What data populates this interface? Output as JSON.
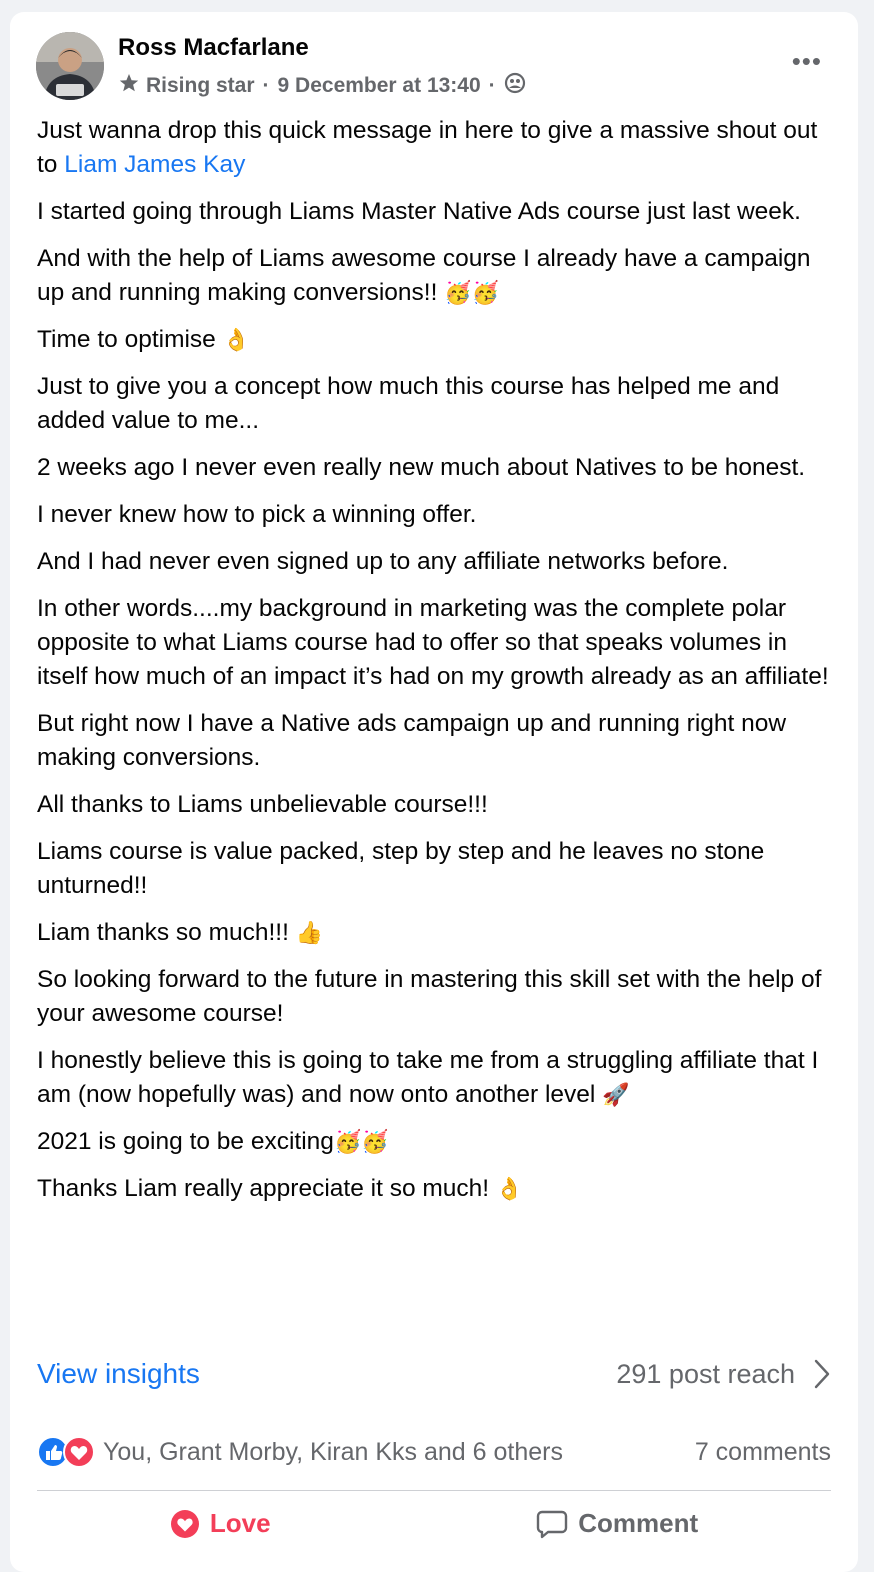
{
  "post": {
    "author": "Ross Macfarlane",
    "badge": "Rising star",
    "timestamp": "9 December at 13:40",
    "separator": "·",
    "paragraphs": [
      {
        "pre": "Just wanna drop this quick message in here to give a massive shout out to ",
        "mention": "Liam James Kay",
        "post": ""
      },
      {
        "pre": "I started going through Liams Master Native Ads course just last week.",
        "mention": "",
        "post": ""
      },
      {
        "pre": "And with the help of Liams awesome course I already have a campaign up and running making conversions!! ",
        "mention": "",
        "post": "🥳🥳"
      },
      {
        "pre": "Time to optimise ",
        "mention": "",
        "post": "👌"
      },
      {
        "pre": "Just to give you a concept how much this course has helped me and added value to me...",
        "mention": "",
        "post": ""
      },
      {
        "pre": "2 weeks ago I never even really new much about Natives to be honest.",
        "mention": "",
        "post": ""
      },
      {
        "pre": "I never knew how to pick a winning offer.",
        "mention": "",
        "post": ""
      },
      {
        "pre": "And I had never even signed up to any affiliate networks before.",
        "mention": "",
        "post": ""
      },
      {
        "pre": "In other words....my background in marketing was the complete polar opposite to what Liams course had to offer so that speaks volumes in itself how much of an impact it’s had on my growth already as an affiliate!",
        "mention": "",
        "post": ""
      },
      {
        "pre": "But right now I have a Native ads campaign up and running right now making conversions.",
        "mention": "",
        "post": ""
      },
      {
        "pre": "All thanks to Liams unbelievable course!!!",
        "mention": "",
        "post": ""
      },
      {
        "pre": "Liams course is value packed, step by step and he leaves no stone unturned!!",
        "mention": "",
        "post": ""
      },
      {
        "pre": "Liam thanks so much!!! ",
        "mention": "",
        "post": "👍"
      },
      {
        "pre": "So looking forward to the future in mastering this skill set with the help of your awesome course!",
        "mention": "",
        "post": ""
      },
      {
        "pre": "I honestly believe this is going to take me from a struggling affiliate that I am (now hopefully was) and now onto another level ",
        "mention": "",
        "post": "🚀"
      },
      {
        "pre": "2021 is going to be exciting",
        "mention": "",
        "post": "🥳🥳"
      },
      {
        "pre": "Thanks Liam really appreciate it so much! ",
        "mention": "",
        "post": "👌"
      }
    ]
  },
  "insights": {
    "label": "View insights",
    "reach": "291 post reach"
  },
  "reactions": {
    "names": "You, Grant Morby, Kiran Kks and 6 others",
    "comments": "7 comments"
  },
  "actions": {
    "love": "Love",
    "comment": "Comment"
  },
  "colors": {
    "link": "#1877f2",
    "love": "#f33e58",
    "muted": "#65676b"
  }
}
